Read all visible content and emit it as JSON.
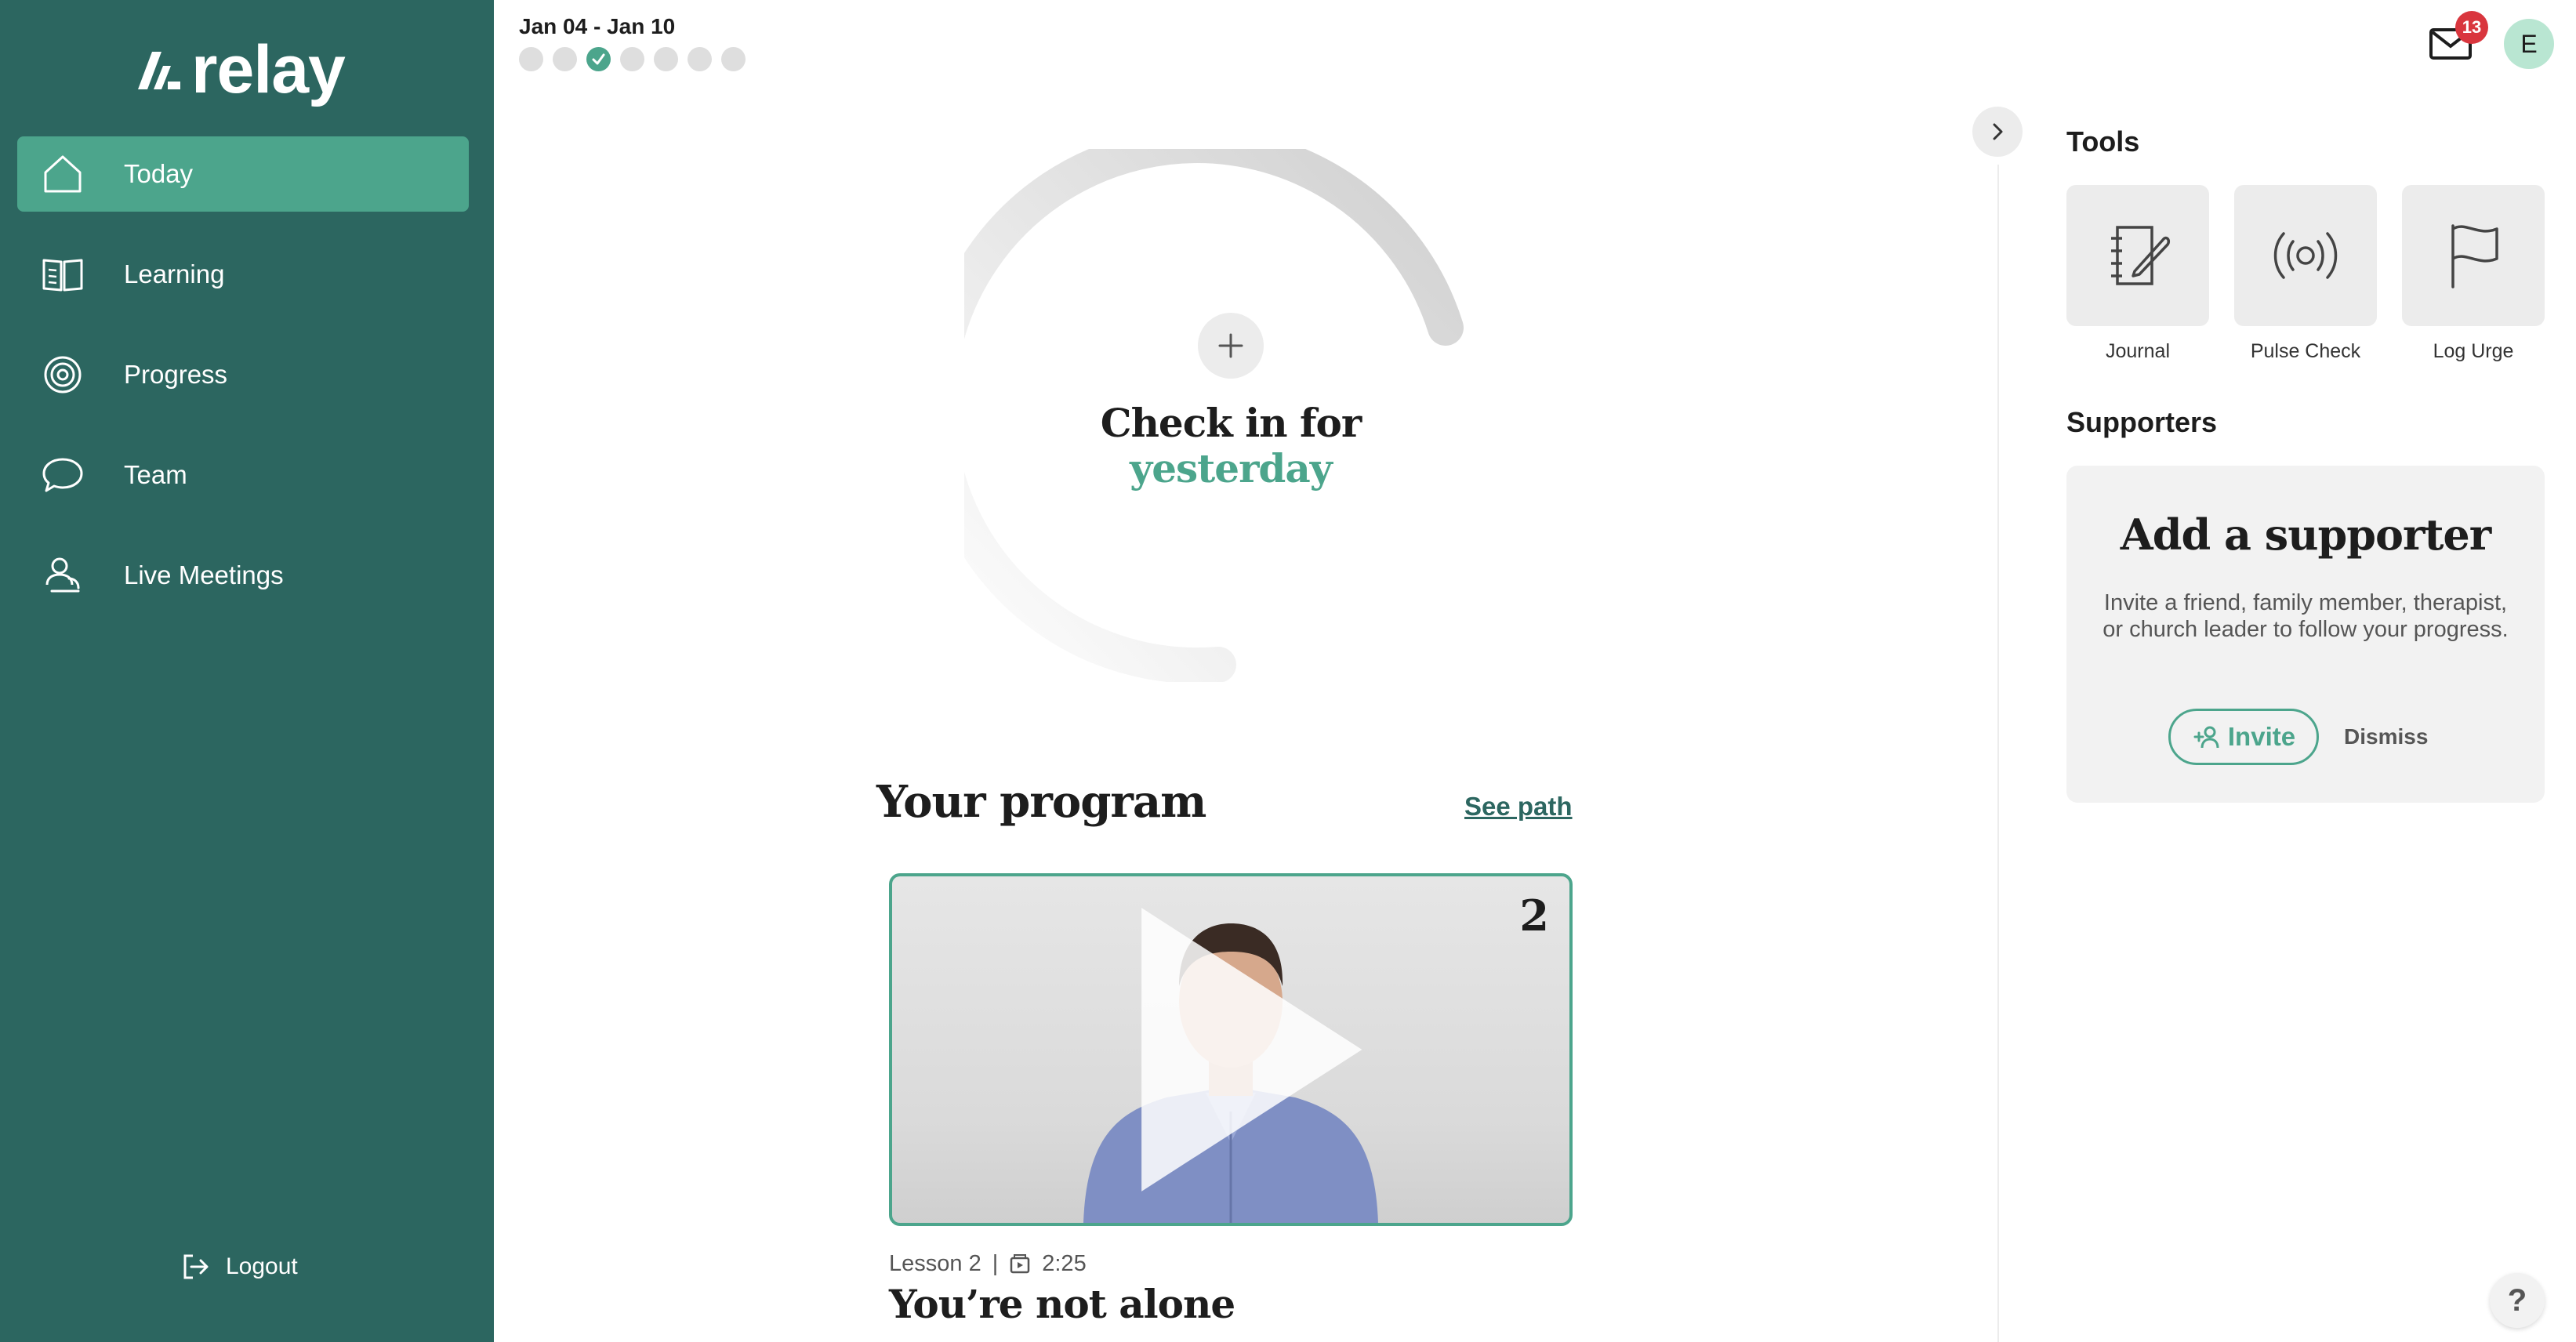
{
  "app": {
    "logo_text": "relay"
  },
  "sidebar": {
    "items": [
      {
        "label": "Today",
        "icon": "home-icon",
        "active": true
      },
      {
        "label": "Learning",
        "icon": "book-icon",
        "active": false
      },
      {
        "label": "Progress",
        "icon": "target-icon",
        "active": false
      },
      {
        "label": "Team",
        "icon": "chat-bubble-icon",
        "active": false
      },
      {
        "label": "Live Meetings",
        "icon": "people-icon",
        "active": false
      }
    ],
    "logout_label": "Logout"
  },
  "header": {
    "week_range": "Jan 04 - Jan 10",
    "week_days_checked": [
      false,
      false,
      true,
      false,
      false,
      false,
      false
    ],
    "mail_count": "13",
    "avatar_initial": "E"
  },
  "checkin": {
    "line1": "Check in for",
    "line2": "yesterday"
  },
  "program": {
    "title": "Your program",
    "see_path_label": "See path",
    "lesson_number": "2",
    "lesson_label": "Lesson 2",
    "separator": "|",
    "duration": "2:25",
    "lesson_title": "You’re not alone"
  },
  "tools": {
    "title": "Tools",
    "items": [
      {
        "label": "Journal",
        "icon": "journal-icon"
      },
      {
        "label": "Pulse Check",
        "icon": "pulse-icon"
      },
      {
        "label": "Log Urge",
        "icon": "flag-icon"
      }
    ]
  },
  "supporters": {
    "title": "Supporters",
    "card_title": "Add a supporter",
    "card_description": "Invite a friend, family member, therapist, or church leader to follow your progress.",
    "invite_label": "Invite",
    "dismiss_label": "Dismiss"
  },
  "help_label": "?",
  "colors": {
    "sidebar_bg": "#2c6660",
    "accent": "#4ca58c",
    "badge": "#d9363e"
  }
}
